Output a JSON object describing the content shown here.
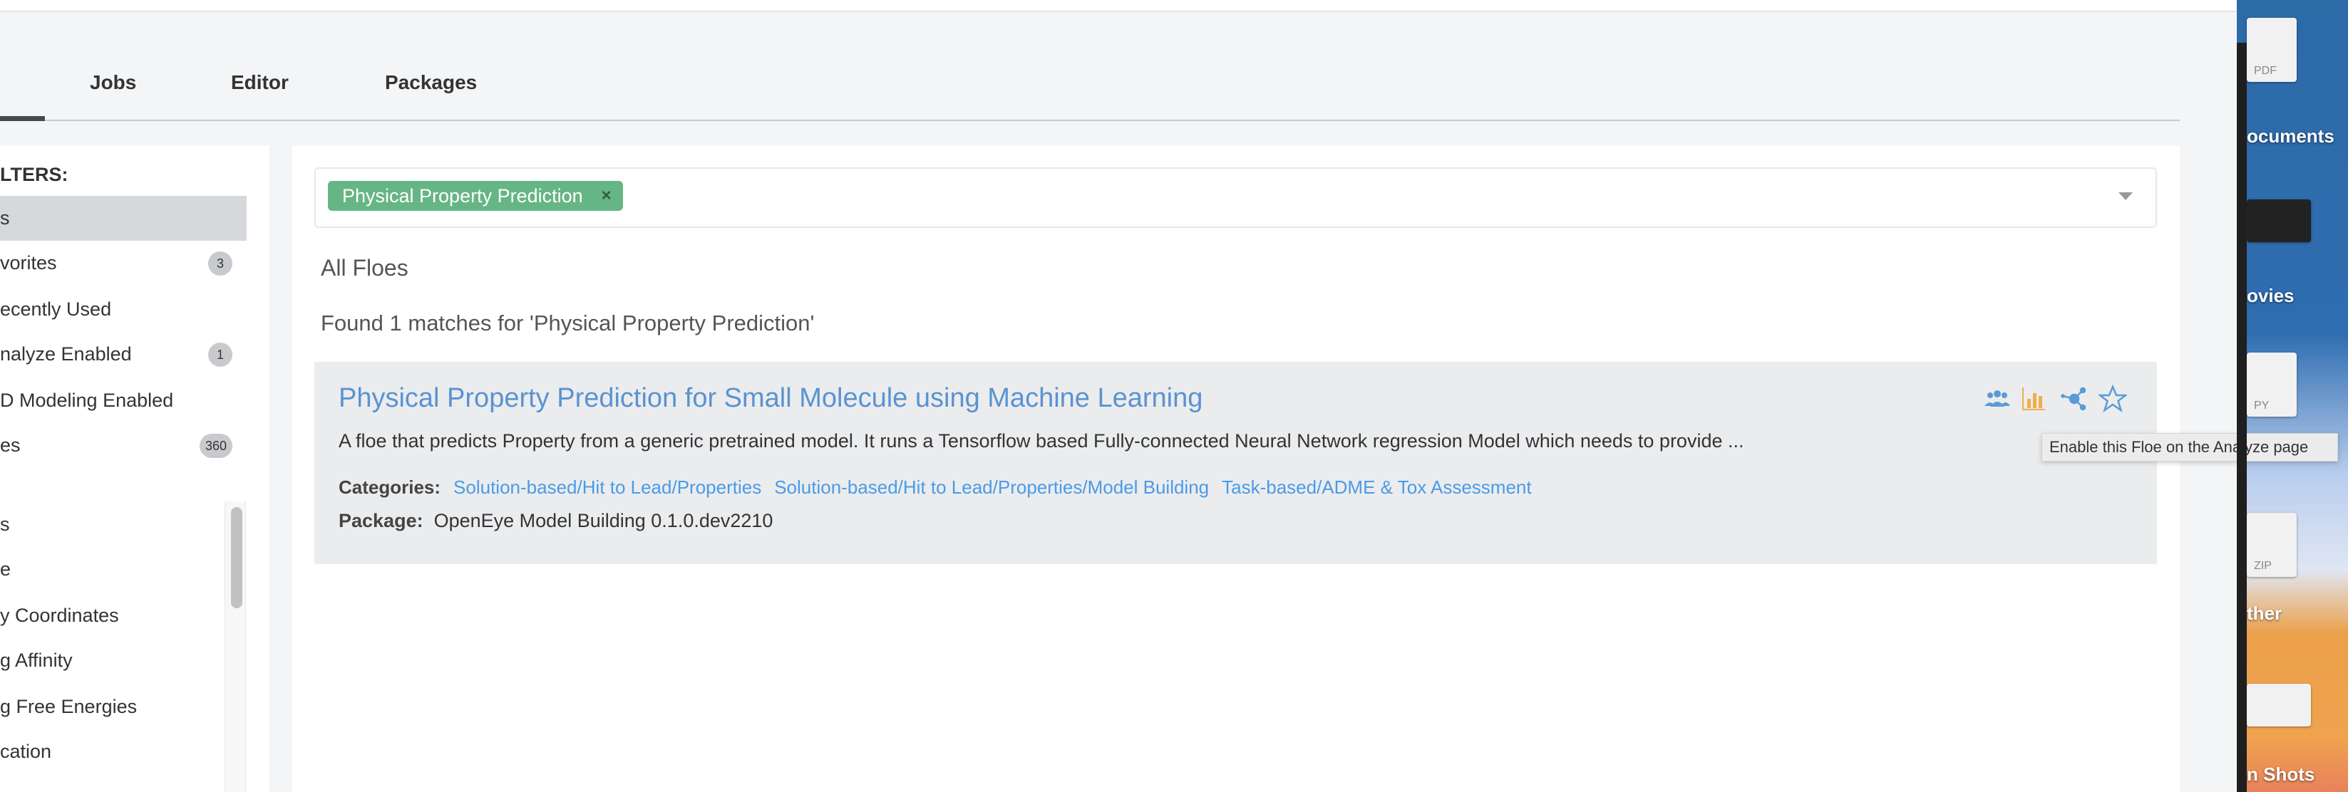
{
  "tabs": [
    {
      "label": "Jobs"
    },
    {
      "label": "Editor"
    },
    {
      "label": "Packages"
    }
  ],
  "sidebar": {
    "filters_heading": "LTERS:",
    "filters": [
      {
        "label": "s",
        "selected": true
      },
      {
        "label": "vorites",
        "badge": "3"
      },
      {
        "label": "ecently Used"
      },
      {
        "label": "nalyze Enabled",
        "badge": "1"
      },
      {
        "label": "D Modeling Enabled"
      },
      {
        "label": "es",
        "badge": "360"
      }
    ],
    "categories": [
      {
        "label": "s"
      },
      {
        "label": "e"
      },
      {
        "label": "y Coordinates"
      },
      {
        "label": "g Affinity"
      },
      {
        "label": "g Free Energies"
      },
      {
        "label": "cation"
      }
    ]
  },
  "search": {
    "chip": "Physical Property Prediction",
    "chip_remove": "×"
  },
  "main": {
    "heading": "All Floes",
    "found_text": "Found 1 matches for 'Physical Property Prediction'",
    "card": {
      "title": "Physical Property Prediction for Small Molecule using Machine Learning",
      "description": "A floe that predicts Property from a generic pretrained model. It runs a Tensorflow based Fully-connected Neural Network regression Model which needs to provide ...",
      "categories_label": "Categories:",
      "categories": [
        "Solution-based/Hit to Lead/Properties",
        "Solution-based/Hit to Lead/Properties/Model Building",
        "Task-based/ADME & Tox Assessment"
      ],
      "package_label": "Package:",
      "package": "OpenEye Model Building 0.1.0.dev2210",
      "icons": [
        "users-icon",
        "bar-chart-icon",
        "share-icon",
        "star-icon"
      ]
    },
    "tooltip": "Enable this Floe on the Analyze page"
  },
  "desktop": {
    "labels": [
      "ocuments",
      "ovies",
      "ther",
      "n Shots"
    ],
    "file_labels": [
      "PDF",
      "PY",
      "ZIP"
    ]
  },
  "colors": {
    "chip": "#66b585",
    "title": "#5a93d1",
    "link": "#4a9be8",
    "analyze_icon": "#f0ad4e",
    "icons": "#5b9bd5"
  }
}
